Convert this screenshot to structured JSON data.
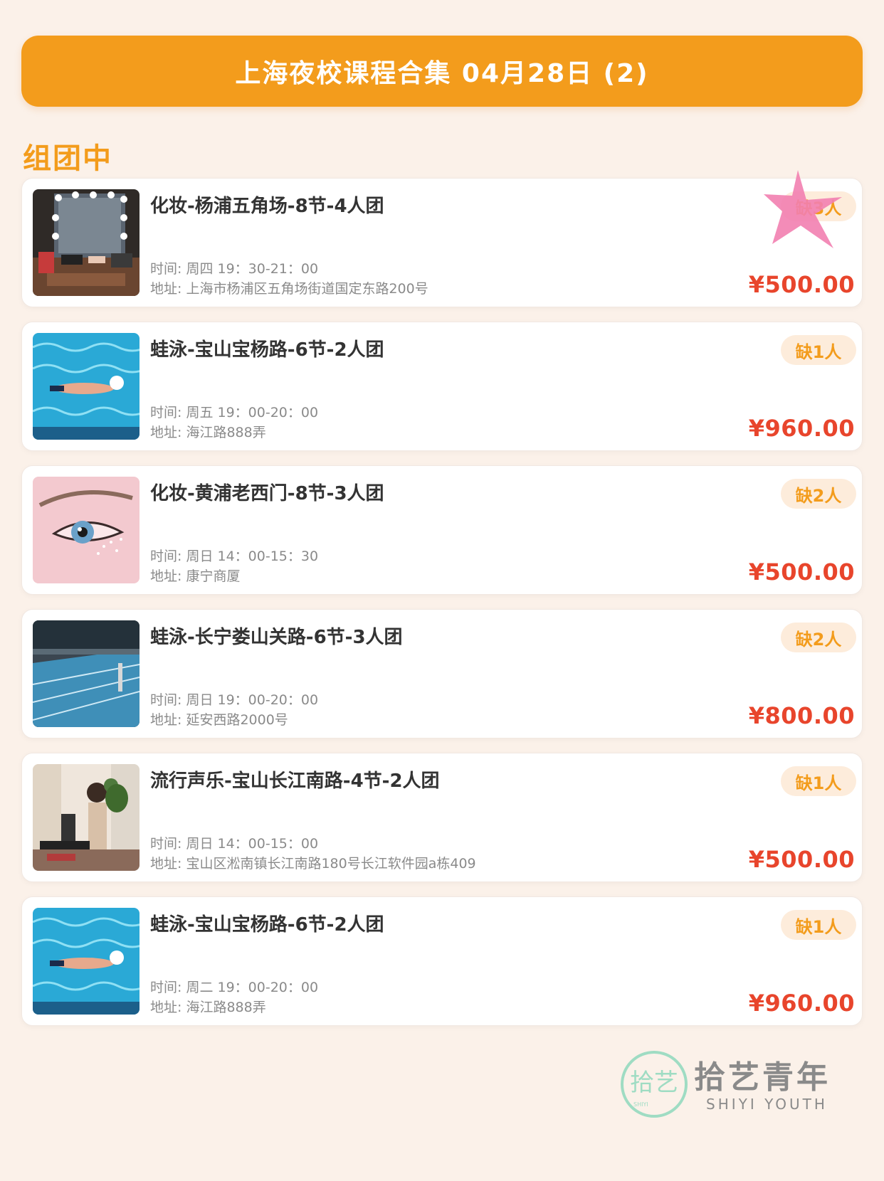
{
  "header": {
    "title": "上海夜校课程合集 04月28日 (2)"
  },
  "section": {
    "title": "组团中"
  },
  "colors": {
    "accent": "#f39c1c",
    "price": "#e8452c",
    "badge_bg": "#fdecdb"
  },
  "courses": [
    {
      "title": "化妆-杨浦五角场-8节-4人团",
      "time": "时间: 周四 19：30-21：00",
      "address": "地址: 上海市杨浦区五角场街道国定东路200号",
      "badge": "缺3人",
      "price": "¥500.00",
      "image": "makeup-mirror-photo"
    },
    {
      "title": "蛙泳-宝山宝杨路-6节-2人团",
      "time": "时间: 周五 19：00-20：00",
      "address": "地址: 海江路888弄",
      "badge": "缺1人",
      "price": "¥960.00",
      "image": "swimmer-pool-photo"
    },
    {
      "title": "化妆-黄浦老西门-8节-3人团",
      "time": "时间: 周日 14：00-15：30",
      "address": "地址: 康宁商厦",
      "badge": "缺2人",
      "price": "¥500.00",
      "image": "eye-makeup-photo"
    },
    {
      "title": "蛙泳-长宁娄山关路-6节-3人团",
      "time": "时间: 周日 19：00-20：00",
      "address": "地址: 延安西路2000号",
      "badge": "缺2人",
      "price": "¥800.00",
      "image": "indoor-pool-photo"
    },
    {
      "title": "流行声乐-宝山长江南路-4节-2人团",
      "time": "时间: 周日 14：00-15：00",
      "address": "地址: 宝山区淞南镇长江南路180号长江软件园a栋409",
      "badge": "缺1人",
      "price": "¥500.00",
      "image": "singer-studio-photo"
    },
    {
      "title": "蛙泳-宝山宝杨路-6节-2人团",
      "time": "时间: 周二 19：00-20：00",
      "address": "地址: 海江路888弄",
      "badge": "缺1人",
      "price": "¥960.00",
      "image": "swimmer-pool-photo"
    }
  ],
  "logo": {
    "name": "拾艺青年",
    "subtitle": "SHIYI YOUTH",
    "mark_text": "拾艺",
    "mark_sub": "SHIYI"
  }
}
